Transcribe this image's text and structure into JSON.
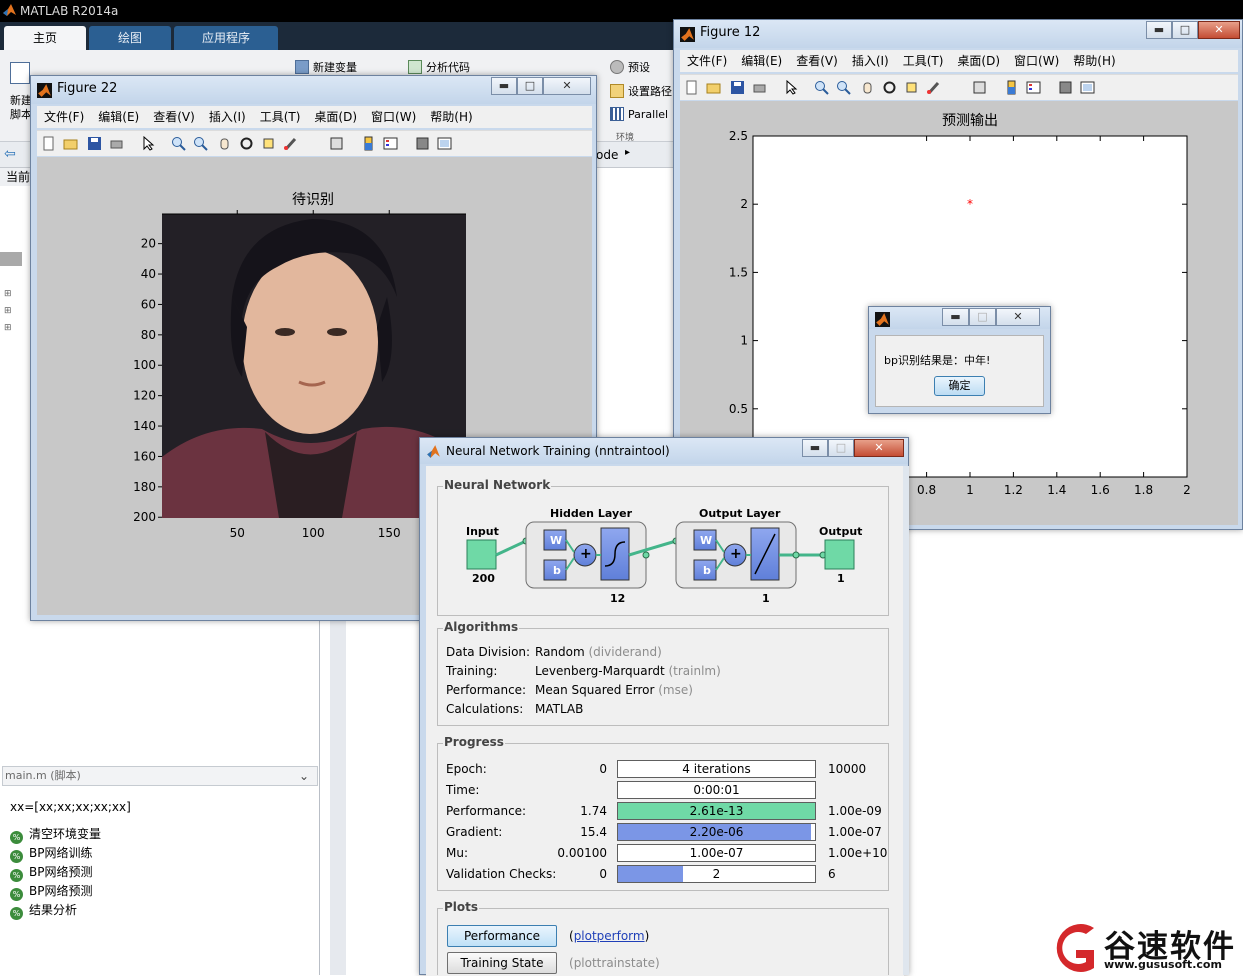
{
  "matlab": {
    "title": "MATLAB R2014a",
    "tabs": [
      "主页",
      "绘图",
      "应用程序"
    ],
    "toolstrip": {
      "new_var": "新建变量",
      "analyze_code": "分析代码",
      "preferences": "预设",
      "set_path": "设置路径",
      "parallel": "Parallel",
      "env_group": "环境",
      "new_label": "新建",
      "script_label": "脚本"
    },
    "addr_fragment": "ode",
    "current_folder_label": "当前",
    "editor_tab": "main.m",
    "editor_tab_kind": "(脚本)",
    "editor_line": "xx=[xx;xx;xx;xx;xx]",
    "cells": [
      "清空环境变量",
      "BP网络训练",
      "BP网络预测",
      "BP网络预测",
      "结果分析"
    ]
  },
  "fig22": {
    "title": "Figure 22",
    "menus": [
      "文件(F)",
      "编辑(E)",
      "查看(V)",
      "插入(I)",
      "工具(T)",
      "桌面(D)",
      "窗口(W)",
      "帮助(H)"
    ],
    "axes_title": "待识别",
    "yticks": [
      "20",
      "40",
      "60",
      "80",
      "100",
      "120",
      "140",
      "160",
      "180",
      "200"
    ],
    "xticks": [
      "50",
      "100",
      "150"
    ]
  },
  "fig12": {
    "title": "Figure 12",
    "menus": [
      "文件(F)",
      "编辑(E)",
      "查看(V)",
      "插入(I)",
      "工具(T)",
      "桌面(D)",
      "窗口(W)",
      "帮助(H)"
    ],
    "axes_title": "预测输出",
    "yticks": [
      "2.5",
      "2",
      "1.5",
      "1",
      "0.5"
    ],
    "xticks": [
      "0.8",
      "1",
      "1.2",
      "1.4",
      "1.6",
      "1.8",
      "2"
    ]
  },
  "chart_data": {
    "type": "scatter",
    "title": "预测输出",
    "xlim": [
      0,
      2
    ],
    "ylim": [
      0,
      2.5
    ],
    "series": [
      {
        "x": [
          1
        ],
        "y": [
          2
        ],
        "marker": "*",
        "color": "#ff0000"
      }
    ]
  },
  "dialog": {
    "message": "bp识别结果是：中年!",
    "ok": "确定"
  },
  "nntool": {
    "title": "Neural Network Training (nntraintool)",
    "network_group": "Neural Network",
    "input_label": "Input",
    "input_size": "200",
    "hidden_label": "Hidden Layer",
    "hidden_size": "12",
    "output_layer_label": "Output Layer",
    "output_layer_size": "1",
    "output_label": "Output",
    "output_size": "1",
    "w": "W",
    "b": "b",
    "algorithms_group": "Algorithms",
    "algorithms": [
      {
        "label": "Data Division:",
        "value": "Random",
        "fn": "(dividerand)"
      },
      {
        "label": "Training:",
        "value": "Levenberg-Marquardt",
        "fn": "(trainlm)"
      },
      {
        "label": "Performance:",
        "value": "Mean Squared Error",
        "fn": "(mse)"
      },
      {
        "label": "Calculations:",
        "value": "MATLAB",
        "fn": ""
      }
    ],
    "progress_group": "Progress",
    "progress": [
      {
        "label": "Epoch:",
        "start": "0",
        "current": "4 iterations",
        "end": "10000",
        "fill": 0,
        "color": "#ffffff"
      },
      {
        "label": "Time:",
        "start": "",
        "current": "0:00:01",
        "end": "",
        "fill": 0,
        "color": "#ffffff"
      },
      {
        "label": "Performance:",
        "start": "1.74",
        "current": "2.61e-13",
        "end": "1.00e-09",
        "fill": 1,
        "color": "#6fd9a6"
      },
      {
        "label": "Gradient:",
        "start": "15.4",
        "current": "2.20e-06",
        "end": "1.00e-07",
        "fill": 0.98,
        "color": "#7b96e6"
      },
      {
        "label": "Mu:",
        "start": "0.00100",
        "current": "1.00e-07",
        "end": "1.00e+10",
        "fill": 0,
        "color": "#ffffff"
      },
      {
        "label": "Validation Checks:",
        "start": "0",
        "current": "2",
        "end": "6",
        "fill": 0.33,
        "color": "#7b96e6"
      }
    ],
    "plots_group": "Plots",
    "plots": [
      {
        "button": "Performance",
        "fn": "plotperform",
        "link": true
      },
      {
        "button": "Training State",
        "fn": "plottrainstate",
        "link": false
      }
    ]
  },
  "watermark": {
    "text": "谷速软件",
    "url": "www.gususoft.com"
  }
}
